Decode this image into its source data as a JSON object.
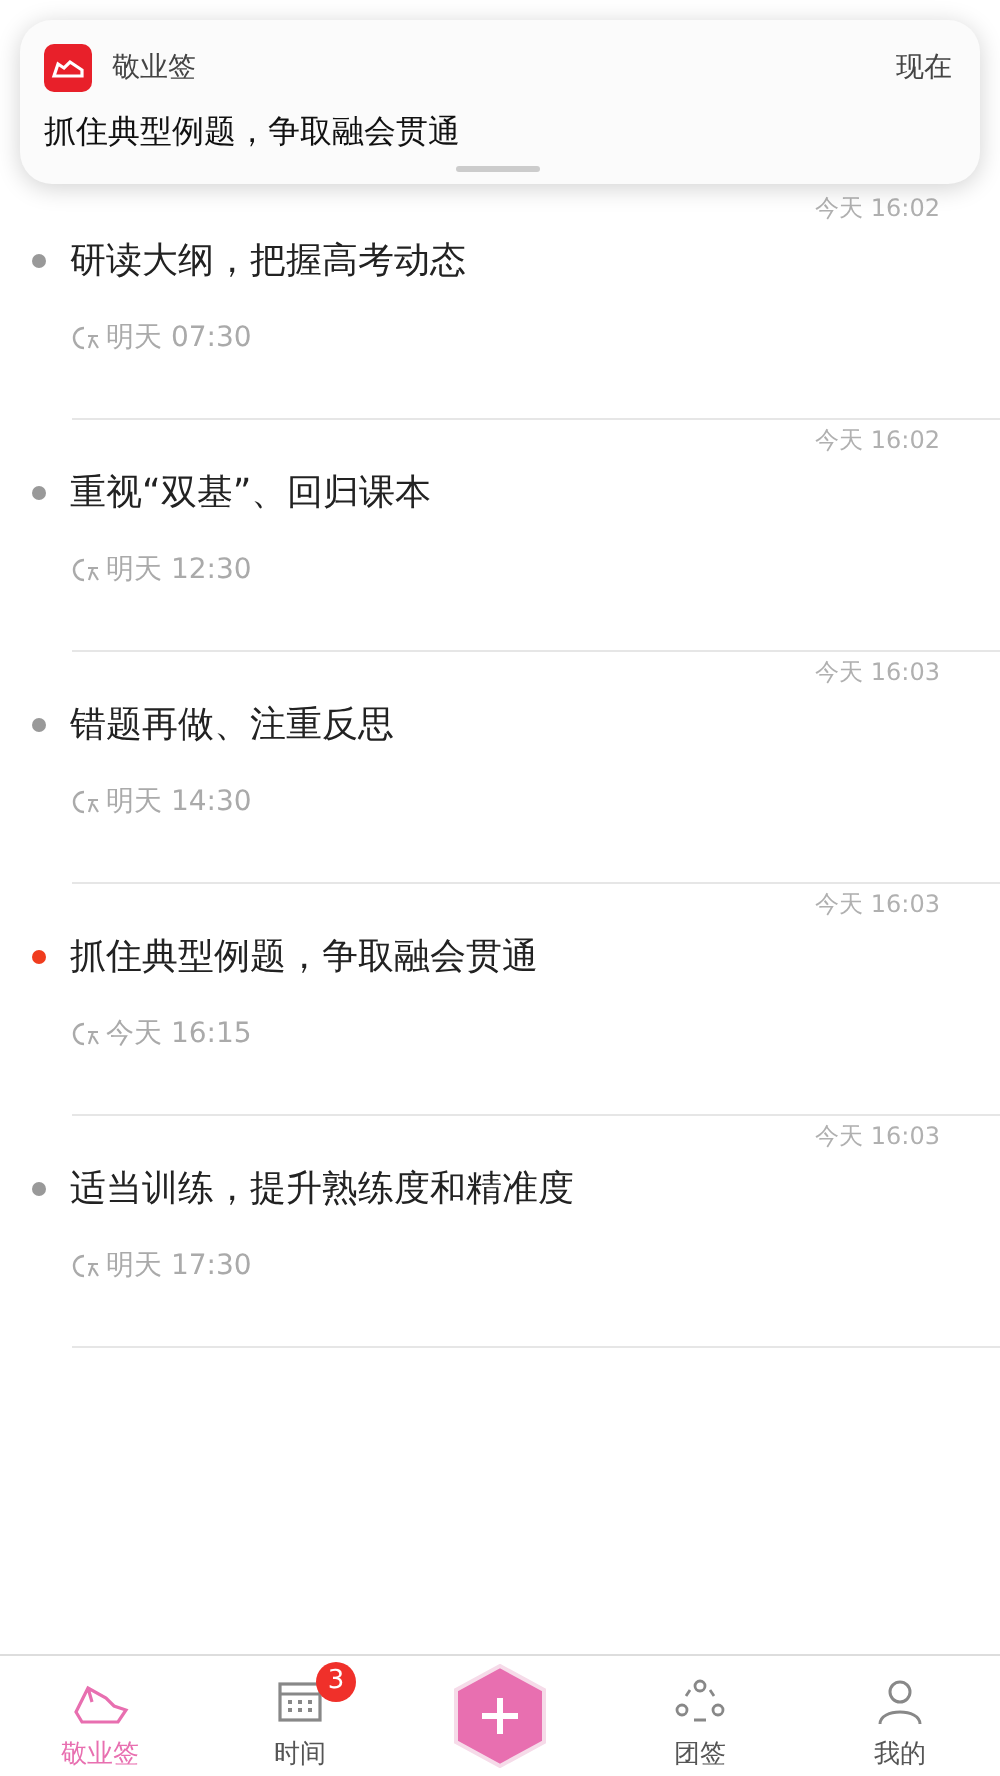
{
  "notification": {
    "app_name": "敬业签",
    "time": "现在",
    "message": "抓住典型例题，争取融会贯通"
  },
  "notes": [
    {
      "created": "今天 16:02",
      "title": "研读大纲，把握高考动态",
      "remind": "明天 07:30",
      "color": "#999999"
    },
    {
      "created": "今天 16:02",
      "title": "重视“双基”、回归课本",
      "remind": "明天 12:30",
      "color": "#999999"
    },
    {
      "created": "今天 16:03",
      "title": "错题再做、注重反思",
      "remind": "明天 14:30",
      "color": "#999999"
    },
    {
      "created": "今天 16:03",
      "title": "抓住典型例题，争取融会贯通",
      "remind": "今天 16:15",
      "color": "#f03c1e"
    },
    {
      "created": "今天 16:03",
      "title": "适当训练，提升熟练度和精准度",
      "remind": "明天 17:30",
      "color": "#999999"
    }
  ],
  "tabs": [
    {
      "kind": "notes",
      "label": "敬业签",
      "selected": true
    },
    {
      "kind": "calendar",
      "label": "时间",
      "selected": false,
      "badge": "3"
    },
    {
      "kind": "add"
    },
    {
      "kind": "team",
      "label": "团签",
      "selected": false
    },
    {
      "kind": "profile",
      "label": "我的",
      "selected": false
    }
  ]
}
